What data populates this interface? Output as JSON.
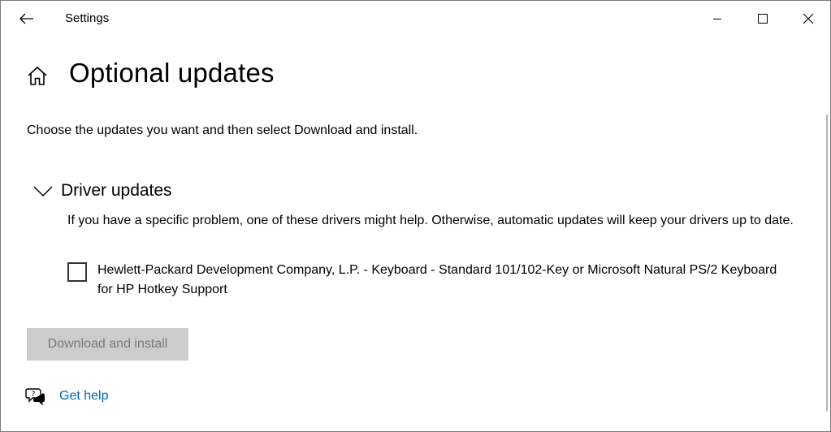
{
  "window": {
    "title": "Settings"
  },
  "header": {
    "page_title": "Optional updates"
  },
  "intro_text": "Choose the updates you want and then select Download and install.",
  "driver_section": {
    "title": "Driver updates",
    "expanded": true,
    "description": "If you have a specific problem, one of these drivers might help. Otherwise, automatic updates will keep your drivers up to date.",
    "items": [
      {
        "label": "Hewlett-Packard Development Company, L.P. - Keyboard - Standard 101/102-Key or Microsoft Natural PS/2 Keyboard for HP Hotkey Support",
        "checked": false
      }
    ]
  },
  "actions": {
    "download_label": "Download and install",
    "download_enabled": false
  },
  "help": {
    "link_label": "Get help"
  },
  "icons": {
    "back": "back-arrow-icon",
    "minimize": "minimize-icon",
    "maximize": "maximize-icon",
    "close": "close-icon",
    "home": "home-icon",
    "chevron": "chevron-down-icon",
    "help": "help-chat-icon"
  },
  "colors": {
    "link": "#0067b8",
    "button_disabled_bg": "#cccccc",
    "button_disabled_text": "#7a7a7a"
  }
}
